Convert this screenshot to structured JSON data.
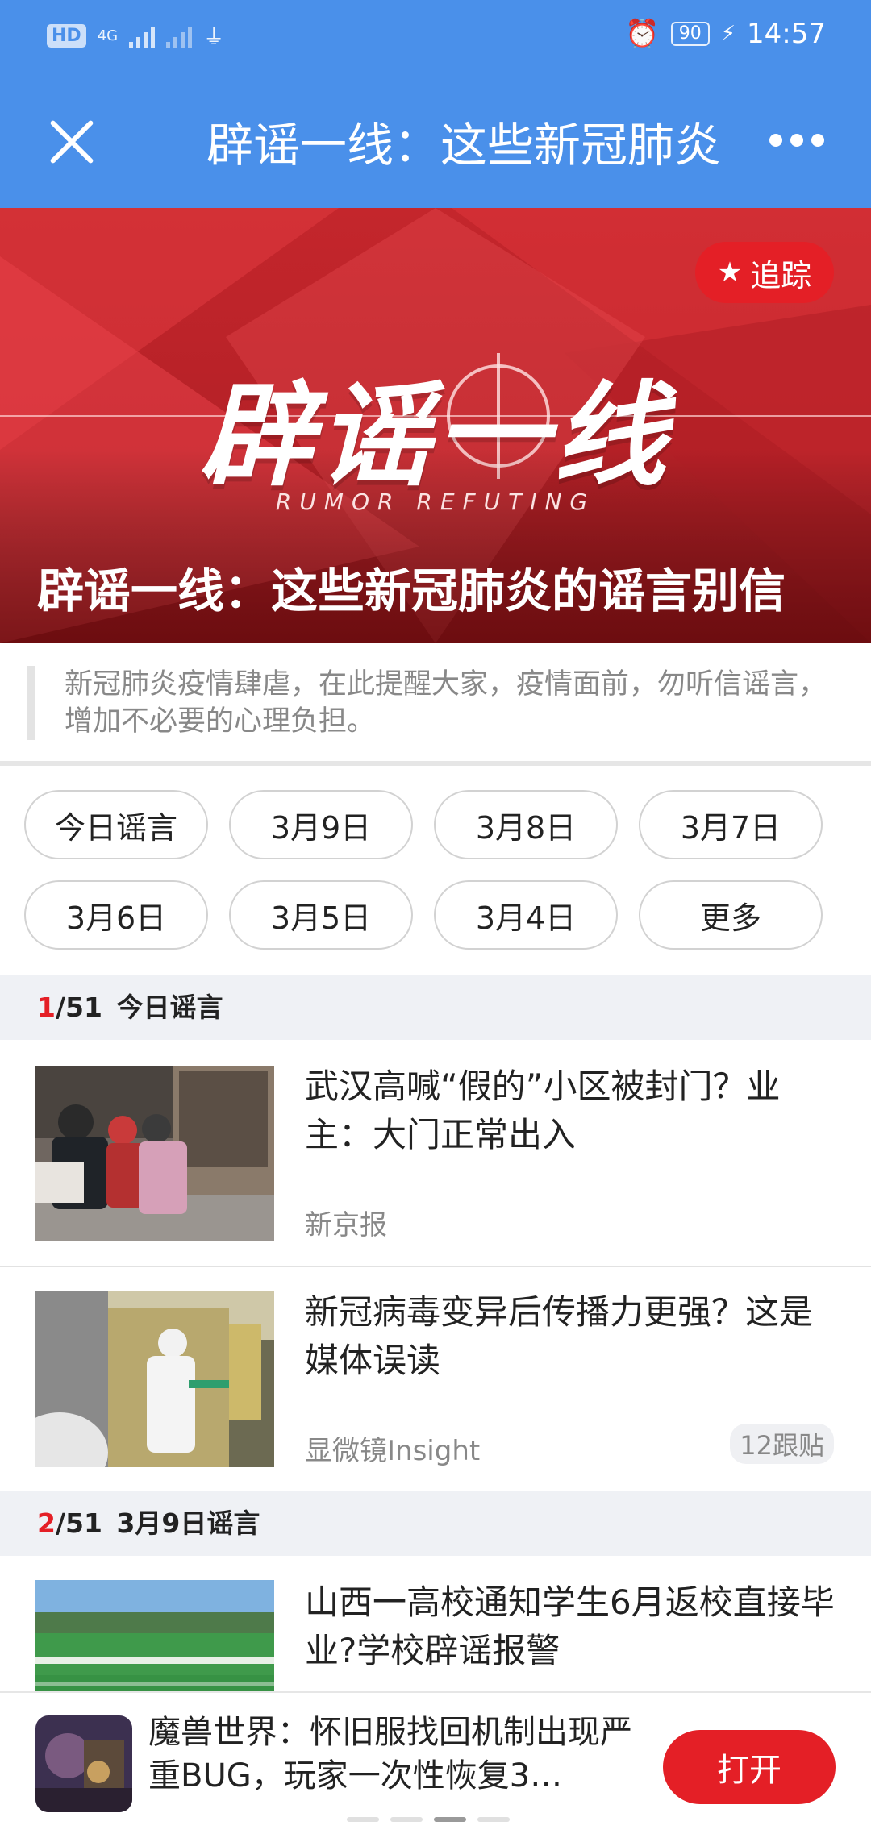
{
  "status_bar": {
    "left": "HD",
    "network": "4G",
    "battery": "90",
    "time": "14:57"
  },
  "nav": {
    "title": "辟谣一线：这些新冠肺炎"
  },
  "hero": {
    "follow_label": "追踪",
    "logo_text": "辟谣一线",
    "logo_sub": "RUMOR REFUTING",
    "title": "辟谣一线：这些新冠肺炎的谣言别信"
  },
  "intro": "新冠肺炎疫情肆虐，在此提醒大家，疫情面前，勿听信谣言，增加不必要的心理负担。",
  "tags": [
    "今日谣言",
    "3月9日",
    "3月8日",
    "3月7日",
    "3月6日",
    "3月5日",
    "3月4日",
    "更多"
  ],
  "sections": [
    {
      "num": "1",
      "total": "/51",
      "label": "今日谣言"
    },
    {
      "num": "2",
      "total": "/51",
      "label": "3月9日谣言"
    }
  ],
  "news": [
    {
      "title": "武汉高喊“假的”小区被封门？业主：大门正常出入",
      "source": "新京报",
      "badge": ""
    },
    {
      "title": "新冠病毒变异后传播力更强？这是媒体误读",
      "source": "显微镜Insight",
      "badge": "12跟贴"
    },
    {
      "title": "山西一高校通知学生6月返校直接毕业?学校辟谣报警",
      "source": "",
      "badge": ""
    }
  ],
  "promo": {
    "text": "魔兽世界：怀旧服找回机制出现严重BUG，玩家一次性恢复3…",
    "button": "打开"
  },
  "colors": {
    "brand_blue": "#4a90ea",
    "accent_red": "#e41f26"
  }
}
